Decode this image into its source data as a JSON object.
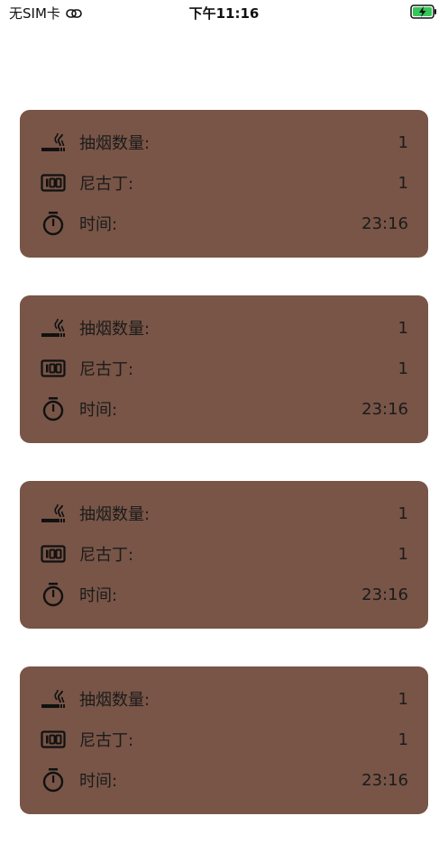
{
  "status_bar": {
    "carrier": "无SIM卡",
    "time": "下午11:16",
    "battery_color": "#34c759"
  },
  "cards": [
    {
      "cigarettes_label": "抽烟数量:",
      "cigarettes_value": "1",
      "nicotine_label": "尼古丁:",
      "nicotine_value": "1",
      "time_label": "时间:",
      "time_value": "23:16"
    },
    {
      "cigarettes_label": "抽烟数量:",
      "cigarettes_value": "1",
      "nicotine_label": "尼古丁:",
      "nicotine_value": "1",
      "time_label": "时间:",
      "time_value": "23:16"
    },
    {
      "cigarettes_label": "抽烟数量:",
      "cigarettes_value": "1",
      "nicotine_label": "尼古丁:",
      "nicotine_value": "1",
      "time_label": "时间:",
      "time_value": "23:16"
    },
    {
      "cigarettes_label": "抽烟数量:",
      "cigarettes_value": "1",
      "nicotine_label": "尼古丁:",
      "nicotine_value": "1",
      "time_label": "时间:",
      "time_value": "23:16"
    }
  ],
  "colors": {
    "card_background": "#785547"
  }
}
